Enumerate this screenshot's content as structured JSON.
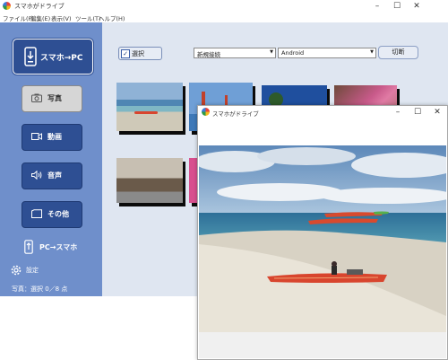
{
  "app": {
    "title": "スマホがドライブ",
    "window_controls": [
      "–",
      "☐",
      "✕"
    ]
  },
  "menu": [
    {
      "label": "ファイル(F)"
    },
    {
      "label": "編集(E)"
    },
    {
      "label": "表示(V)"
    },
    {
      "label": "ツール(T)"
    },
    {
      "label": "ヘルプ(H)"
    }
  ],
  "sidebar": {
    "transfer_label": "スマホ→PC",
    "categories": [
      {
        "label": "写真",
        "icon": "camera-icon",
        "active": true
      },
      {
        "label": "動画",
        "icon": "video-camera-icon",
        "active": false
      },
      {
        "label": "音声",
        "icon": "speaker-icon",
        "active": false
      },
      {
        "label": "その他",
        "icon": "folder-icon",
        "active": false
      }
    ],
    "pc_to_phone_label": "PC→スマホ",
    "settings_label": "設定"
  },
  "toolbar": {
    "select_label": "選択",
    "select_checked": true,
    "device_type": "新規接続",
    "os": "Android",
    "cut_label": "切断"
  },
  "status": {
    "text": "写真：選択 0／8 点"
  },
  "popup": {
    "title": "スマホがドライブ",
    "window_controls": [
      "–",
      "☐",
      "✕"
    ]
  },
  "colors": {
    "sidebar": "#6f8fcb",
    "button": "#2e4f93",
    "content_bg": "#dfe6f1"
  }
}
